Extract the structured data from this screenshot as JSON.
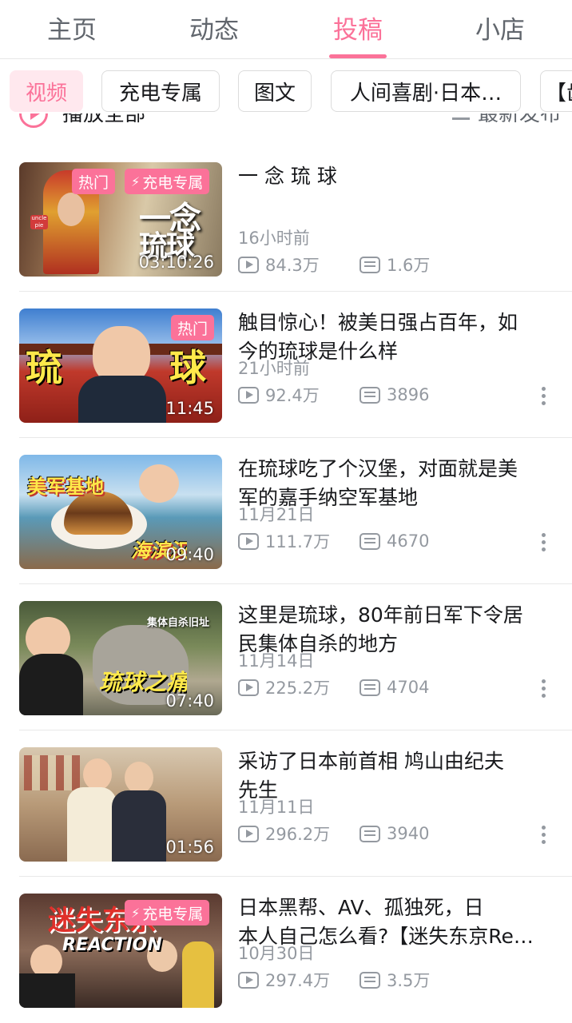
{
  "top_tabs": [
    {
      "label": "主页",
      "active": false
    },
    {
      "label": "动态",
      "active": false
    },
    {
      "label": "投稿",
      "active": true
    },
    {
      "label": "小店",
      "active": false
    }
  ],
  "chips": [
    {
      "label": "视频",
      "active": true
    },
    {
      "label": "充电专属",
      "active": false
    },
    {
      "label": "图文",
      "active": false
    },
    {
      "label": "人间喜剧·日本…",
      "active": false
    },
    {
      "label": "【齿",
      "active": false
    }
  ],
  "playbar": {
    "play_all": "播放全部",
    "sort": "最新发布"
  },
  "colors": {
    "accent": "#fb7299",
    "muted": "#9499a0"
  },
  "videos": [
    {
      "title_lines": [
        "一 念 琉 球"
      ],
      "time": "16小时前",
      "views": "84.3万",
      "danmaku": "1.6万",
      "duration": "03:10:26",
      "badges": [
        "热门",
        "充电专属"
      ],
      "thumb_text": [
        "一念",
        "琉球"
      ],
      "has_more": false
    },
    {
      "title_lines": [
        "触目惊心！被美日强占百年，如",
        "今的琉球是什么样"
      ],
      "time": "21小时前",
      "views": "92.4万",
      "danmaku": "3896",
      "duration": "11:45",
      "badges": [
        "热门"
      ],
      "thumb_text": [
        "琉",
        "球"
      ],
      "has_more": true
    },
    {
      "title_lines": [
        "在琉球吃了个汉堡，对面就是美",
        "军的嘉手纳空军基地"
      ],
      "time": "11月21日",
      "views": "111.7万",
      "danmaku": "4670",
      "duration": "09:40",
      "badges": [],
      "thumb_text": [
        "美军基地",
        "海滨汉堡"
      ],
      "has_more": true
    },
    {
      "title_lines": [
        "这里是琉球，80年前日军下令居",
        "民集体自杀的地方"
      ],
      "time": "11月14日",
      "views": "225.2万",
      "danmaku": "4704",
      "duration": "07:40",
      "badges": [],
      "thumb_text": [
        "集体自杀旧址",
        "琉球之痛"
      ],
      "has_more": true
    },
    {
      "title_lines": [
        "采访了日本前首相 鸠山由纪夫",
        "先生"
      ],
      "time": "11月11日",
      "views": "296.2万",
      "danmaku": "3940",
      "duration": "01:56",
      "badges": [],
      "thumb_text": [],
      "has_more": true
    },
    {
      "title_lines": [
        "日本黑帮、AV、孤独死，日",
        "本人自己怎么看?【迷失东京Re…"
      ],
      "time": "10月30日",
      "views": "297.4万",
      "danmaku": "3.5万",
      "duration": "",
      "badges": [
        "充电专属"
      ],
      "thumb_text": [
        "迷失东京",
        "REACTION"
      ],
      "has_more": false
    }
  ]
}
